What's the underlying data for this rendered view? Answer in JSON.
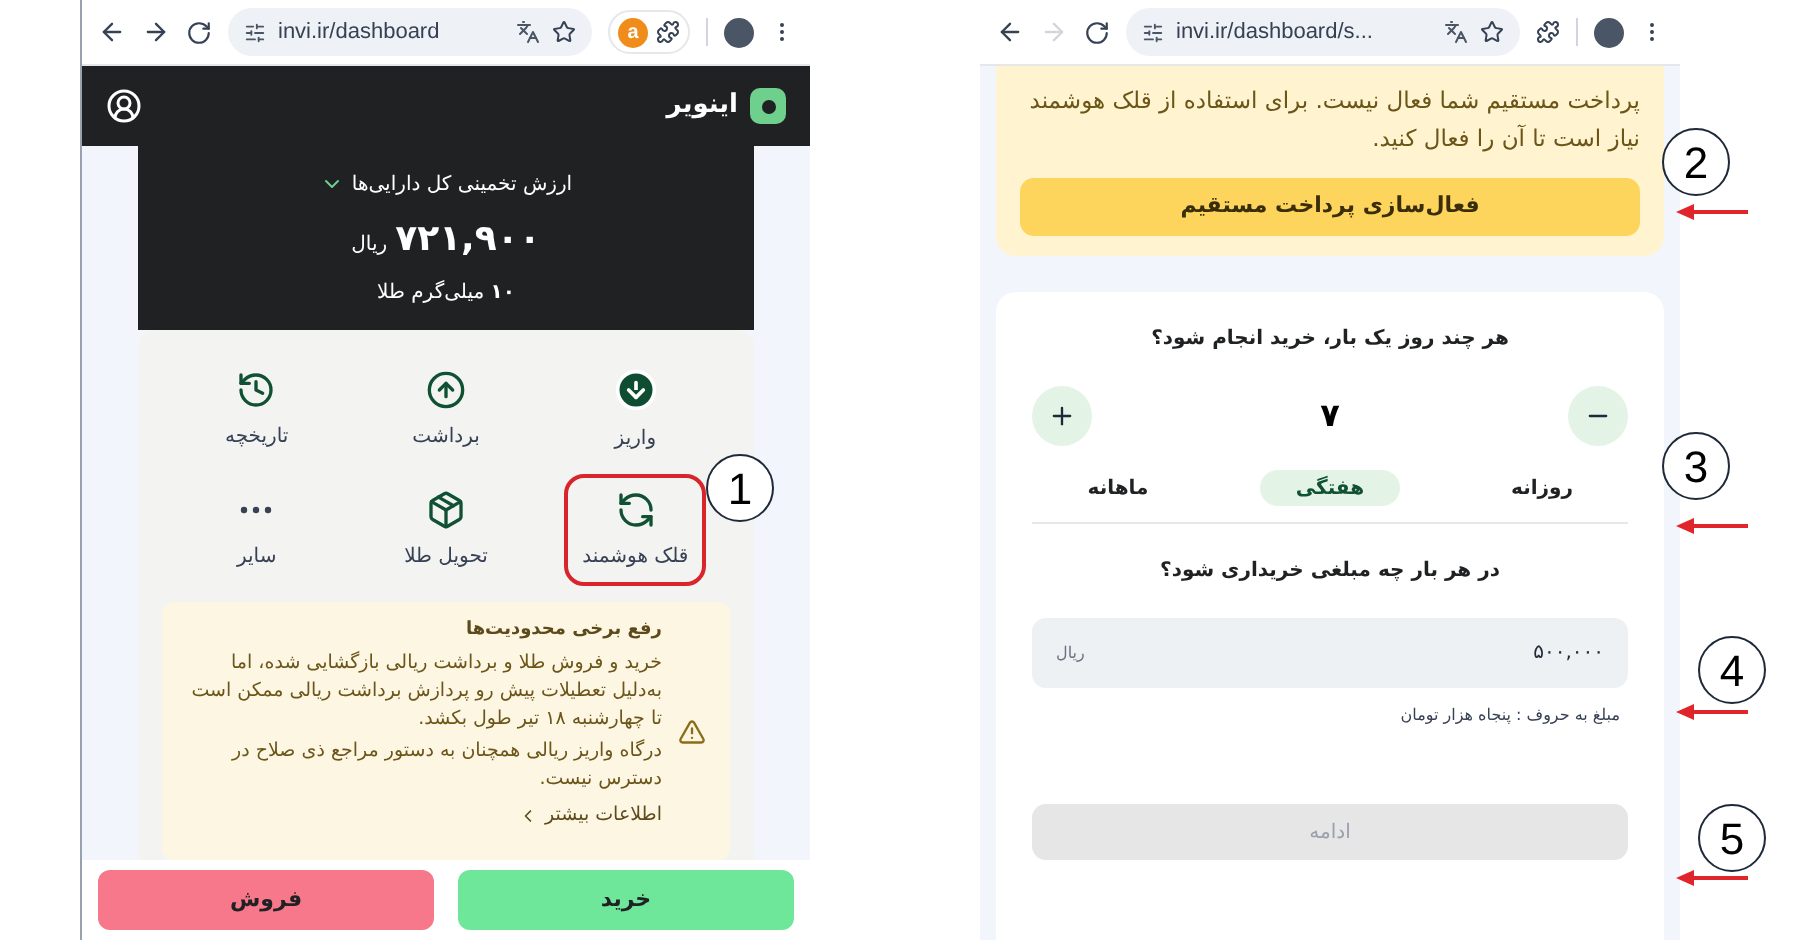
{
  "left_screen": {
    "browser": {
      "url": "invi.ir/dashboard",
      "forward_enabled": true,
      "extension_badge": "a"
    },
    "brand": "اینویر",
    "balance": {
      "label": "ارزش تخمینی کل دارایی‌ها",
      "amount": "۷۲۱,۹۰۰",
      "currency": "ریال",
      "gold": "**۱۰** میلی‌گرم طلا"
    },
    "actions": [
      {
        "label": "واریز",
        "kind": "deposit",
        "highlighted": false
      },
      {
        "label": "برداشت",
        "kind": "withdraw",
        "highlighted": false
      },
      {
        "label": "تاریخچه",
        "kind": "history",
        "highlighted": false
      },
      {
        "label": "قلک هوشمند",
        "kind": "piggy",
        "highlighted": true
      },
      {
        "label": "تحویل طلا",
        "kind": "delivery",
        "highlighted": false
      },
      {
        "label": "سایر",
        "kind": "more",
        "highlighted": false
      }
    ],
    "notice": {
      "title": "رفع برخی محدودیت‌ها",
      "paragraphs": [
        "خرید و فروش طلا و برداشت ریالی بازگشایی شده، اما به‌دلیل تعطیلات پیش رو پردازش برداشت ریالی ممکن است تا چهارشنبه ۱۸ تیر طول بکشد.",
        "درگاه واریز ریالی همچنان به دستور مراجع ذی صلاح در دسترس نیست."
      ],
      "link": "اطلاعات بیشتر"
    },
    "buttons": [
      {
        "label": "خرید",
        "kind": "buy"
      },
      {
        "label": "فروش",
        "kind": "sell"
      }
    ]
  },
  "right_screen": {
    "browser": {
      "url": "invi.ir/dashboard/s...",
      "forward_enabled": false
    },
    "notice": {
      "text": "پرداخت مستقیم شما فعال نیست. برای استفاده از قلک هوشمند نیاز است تا آن را فعال کنید.",
      "button": "فعال‌سازی پرداخت مستقیم"
    },
    "frequency": {
      "question": "هر چند روز یک بار، خرید انجام شود؟",
      "value": "۷",
      "periods": [
        {
          "label": "روزانه",
          "selected": false
        },
        {
          "label": "هفتگی",
          "selected": true
        },
        {
          "label": "ماهانه",
          "selected": false
        }
      ]
    },
    "amount": {
      "question": "در هر بار چه مبلغی خریداری شود؟",
      "value": "۵۰۰,۰۰۰",
      "unit": "ریال",
      "in_words": "مبلغ به حروف : پنجاه هزار تومان"
    },
    "continue_button": {
      "label": "ادامه",
      "disabled": true
    }
  },
  "annotations": [
    {
      "label": "1",
      "arrow": false
    },
    {
      "label": "2",
      "arrow": true
    },
    {
      "label": "3",
      "arrow": true
    },
    {
      "label": "4",
      "arrow": true
    },
    {
      "label": "5",
      "arrow": true
    }
  ]
}
